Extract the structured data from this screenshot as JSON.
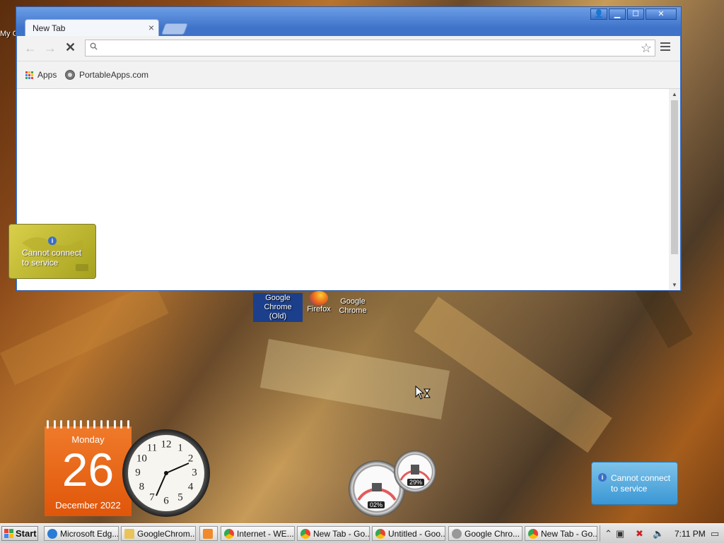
{
  "desktop": {
    "left_edge_label": "My C",
    "icons": [
      {
        "label_line1": "Google",
        "label_line2": "Chrome (Old)"
      },
      {
        "label_line1": "Firefox",
        "label_line2": ""
      },
      {
        "label_line1": "Google",
        "label_line2": "Chrome"
      }
    ]
  },
  "browser": {
    "tab_title": "New Tab",
    "tab_close": "×",
    "window_buttons": {
      "user": "👤",
      "minimize": "▁",
      "maximize": "☐",
      "close": "✕"
    },
    "nav": {
      "back": "←",
      "forward": "→",
      "stop": "✕"
    },
    "omnibox": {
      "value": "",
      "placeholder": ""
    },
    "star": "☆",
    "bookmarks": [
      {
        "label": "Apps",
        "icon": "apps-grid-icon"
      },
      {
        "label": "PortableApps.com",
        "icon": "portableapps-icon"
      }
    ]
  },
  "gadgets": {
    "weather_msg_line1": "Cannot connect",
    "weather_msg_line2": "to service",
    "blue_msg_line1": "Cannot connect",
    "blue_msg_line2": "to service",
    "info_glyph": "i",
    "calendar": {
      "day_name": "Monday",
      "day_num": "26",
      "month_year": "December 2022"
    },
    "clock": {
      "numbers": [
        "12",
        "1",
        "2",
        "3",
        "4",
        "5",
        "6",
        "7",
        "8",
        "9",
        "10",
        "11"
      ],
      "time": "7:11"
    },
    "meters": {
      "cpu_percent": "02%",
      "mem_percent": "29%"
    }
  },
  "taskbar": {
    "start_label": "Start",
    "items": [
      {
        "label": "Microsoft Edg..."
      },
      {
        "label": "GoogleChrom..."
      },
      {
        "label": ""
      },
      {
        "label": "Internet - WE..."
      },
      {
        "label": "New Tab - Go..."
      },
      {
        "label": "Untitled - Goo..."
      },
      {
        "label": "Google Chro..."
      },
      {
        "label": "New Tab - Go..."
      }
    ],
    "clock": "7:11 PM"
  },
  "colors": {
    "window_frame": "#3e73c9",
    "calendar": "#e8621a",
    "weather_gadget": "#c9c03a",
    "blue_gadget": "#4aa3dc"
  }
}
